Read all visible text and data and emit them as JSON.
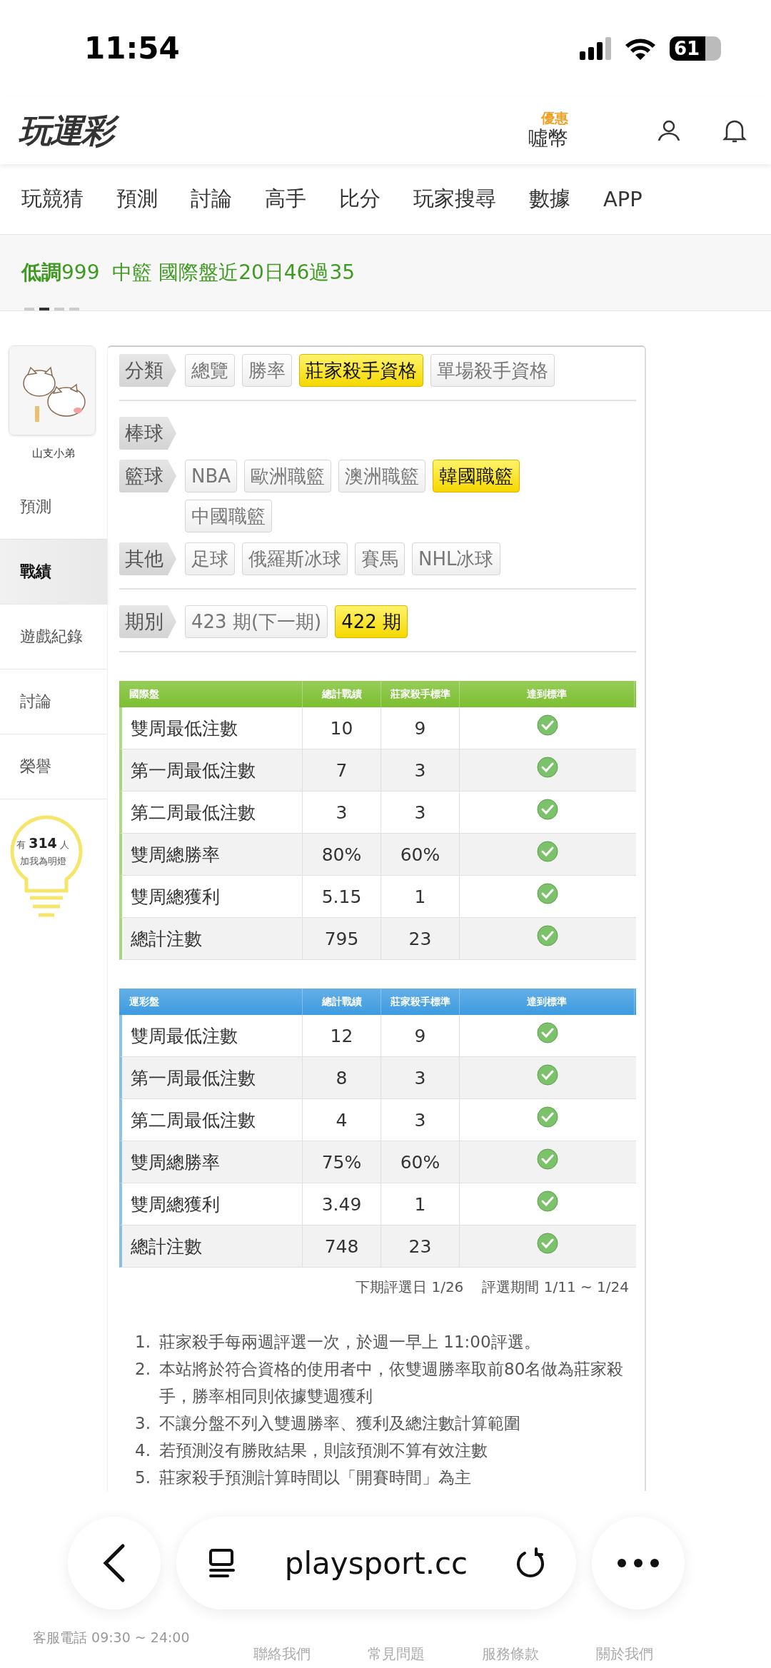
{
  "status_bar": {
    "time": "11:54",
    "battery": "61"
  },
  "header": {
    "logo": "玩運彩",
    "coins_badge": "優惠",
    "coins": "噓幣"
  },
  "nav": [
    "玩競猜",
    "預測",
    "討論",
    "高手",
    "比分",
    "玩家搜尋",
    "數據",
    "APP"
  ],
  "ticker": {
    "text": "**低調**999  中籃 國際盤近20日46過35",
    "pager": [
      {
        "selected": false
      },
      {
        "selected": true
      },
      {
        "selected": false
      },
      {
        "selected": false
      }
    ]
  },
  "sidebar": {
    "username": "山支小弟",
    "items": [
      {
        "label": "預測",
        "selected": false
      },
      {
        "label": "戰績",
        "selected": true
      },
      {
        "label": "遊戲紀錄",
        "selected": false
      },
      {
        "label": "討論",
        "selected": false
      },
      {
        "label": "榮譽",
        "selected": false
      }
    ],
    "fans": {
      "prefix": "有",
      "count": "314",
      "suffix": "人",
      "caption": "加我為明燈"
    }
  },
  "filter_groups": [
    [
      {
        "label": "分類",
        "options": [
          {
            "label": "總覽",
            "selected": false
          },
          {
            "label": "勝率",
            "selected": false
          },
          {
            "label": "莊家殺手資格",
            "selected": true
          },
          {
            "label": "單場殺手資格",
            "selected": false
          }
        ]
      }
    ],
    [
      {
        "label": "棒球"
      },
      {
        "label": "籃球",
        "options": [
          {
            "label": "NBA",
            "selected": false
          },
          {
            "label": "歐洲職籃",
            "selected": false
          },
          {
            "label": "澳洲職籃",
            "selected": false
          },
          {
            "label": "韓國職籃",
            "selected": true
          },
          {
            "label": "中國職籃",
            "selected": false
          }
        ]
      },
      {
        "label": "其他",
        "options": [
          {
            "label": "足球",
            "selected": false
          },
          {
            "label": "俄羅斯冰球",
            "selected": false
          },
          {
            "label": "賽馬",
            "selected": false
          },
          {
            "label": "NHL冰球",
            "selected": false
          }
        ]
      }
    ],
    [
      {
        "label": "期別",
        "options": [
          {
            "label": "423 期(下一期)",
            "selected": false
          },
          {
            "label": "422 期",
            "selected": true
          }
        ]
      }
    ]
  ],
  "tables": [
    {
      "color": "#7cbf30",
      "columns": [
        "國際盤",
        "總計戰績",
        "莊家殺手標準",
        "達到標準"
      ],
      "rows": [
        {
          "item": "雙周最低注數",
          "total": "10",
          "standard": "9",
          "met": true
        },
        {
          "item": "第一周最低注數",
          "total": "7",
          "standard": "3",
          "met": true
        },
        {
          "item": "第二周最低注數",
          "total": "3",
          "standard": "3",
          "met": true
        },
        {
          "item": "雙周總勝率",
          "total": "80%",
          "standard": "60%",
          "met": true
        },
        {
          "item": "雙周總獲利",
          "total": "5.15",
          "standard": "1",
          "met": true
        },
        {
          "item": "總計注數",
          "total": "795",
          "standard": "23",
          "met": true
        }
      ]
    },
    {
      "color": "#3d9be0",
      "columns": [
        "運彩盤",
        "總計戰績",
        "莊家殺手標準",
        "達到標準"
      ],
      "rows": [
        {
          "item": "雙周最低注數",
          "total": "12",
          "standard": "9",
          "met": true
        },
        {
          "item": "第一周最低注數",
          "total": "8",
          "standard": "3",
          "met": true
        },
        {
          "item": "第二周最低注數",
          "total": "4",
          "standard": "3",
          "met": true
        },
        {
          "item": "雙周總勝率",
          "total": "75%",
          "standard": "60%",
          "met": true
        },
        {
          "item": "雙周總獲利",
          "total": "3.49",
          "standard": "1",
          "met": true
        },
        {
          "item": "總計注數",
          "total": "748",
          "standard": "23",
          "met": true
        }
      ]
    }
  ],
  "period_note": [
    "下期評選日 1/26",
    "評選期間 1/11 ~ 1/24"
  ],
  "rules": [
    {
      "number": "1.",
      "text": "莊家殺手每兩週評選一次，於週一早上 11:00評選。"
    },
    {
      "number": "2.",
      "text": "本站將於符合資格的使用者中，依雙週勝率取前80名做為莊家殺手，勝率相同則依據雙週獲利"
    },
    {
      "number": "3.",
      "text": "不讓分盤不列入雙週勝率、獲利及總注數計算範圍"
    },
    {
      "number": "4.",
      "text": "若預測沒有勝敗結果，則該預測不算有效注數"
    },
    {
      "number": "5.",
      "text": "莊家殺手預測計算時間以「開賽時間」為主"
    }
  ],
  "browser_bar": {
    "url": "playsport.cc"
  },
  "footer": {
    "service": "客服電話 09:30 ~ 24:00",
    "links": [
      "聯絡我們",
      "常見問題",
      "服務條款",
      "關於我們"
    ]
  }
}
